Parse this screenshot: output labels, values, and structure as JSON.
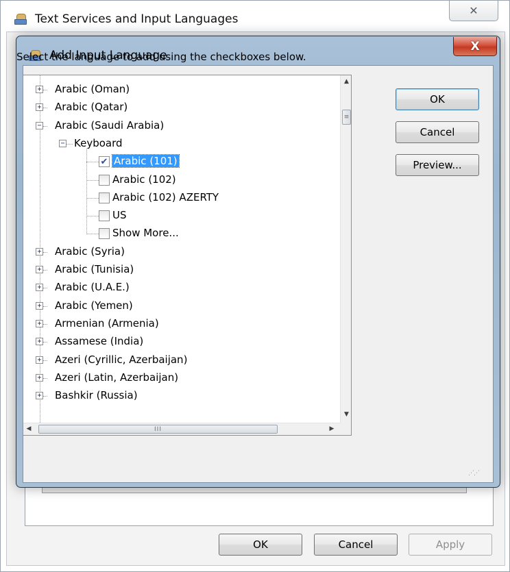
{
  "outer_window": {
    "title": "Text Services and Input Languages",
    "close_glyph": "✕",
    "buttons": {
      "ok": "OK",
      "cancel": "Cancel",
      "apply": "Apply"
    }
  },
  "dialog": {
    "title": "Add Input Language",
    "close_glyph": "X",
    "instruction": "Select the language to add using the checkboxes below.",
    "buttons": {
      "ok": "OK",
      "cancel": "Cancel",
      "preview": "Preview..."
    }
  },
  "tree": {
    "rows": [
      {
        "label": "Arabic (Oman)",
        "level": 0,
        "expander": "+"
      },
      {
        "label": "Arabic (Qatar)",
        "level": 0,
        "expander": "+"
      },
      {
        "label": "Arabic (Saudi Arabia)",
        "level": 0,
        "expander": "−"
      },
      {
        "label": "Keyboard",
        "level": 1,
        "expander": "−"
      },
      {
        "label": "Arabic (101)",
        "level": 2,
        "checked": true,
        "selected": true
      },
      {
        "label": "Arabic (102)",
        "level": 2,
        "checked": false
      },
      {
        "label": "Arabic (102) AZERTY",
        "level": 2,
        "checked": false
      },
      {
        "label": "US",
        "level": 2,
        "checked": false
      },
      {
        "label": "Show More...",
        "level": 2,
        "checked": false
      },
      {
        "label": "Arabic (Syria)",
        "level": 0,
        "expander": "+"
      },
      {
        "label": "Arabic (Tunisia)",
        "level": 0,
        "expander": "+"
      },
      {
        "label": "Arabic (U.A.E.)",
        "level": 0,
        "expander": "+"
      },
      {
        "label": "Arabic (Yemen)",
        "level": 0,
        "expander": "+"
      },
      {
        "label": "Armenian (Armenia)",
        "level": 0,
        "expander": "+"
      },
      {
        "label": "Assamese (India)",
        "level": 0,
        "expander": "+"
      },
      {
        "label": "Azeri (Cyrillic, Azerbaijan)",
        "level": 0,
        "expander": "+"
      },
      {
        "label": "Azeri (Latin, Azerbaijan)",
        "level": 0,
        "expander": "+"
      },
      {
        "label": "Bashkir (Russia)",
        "level": 0,
        "expander": "+"
      }
    ],
    "scroll": {
      "up_glyph": "▲",
      "down_glyph": "▼",
      "left_glyph": "◀",
      "right_glyph": "▶",
      "thumb_grip": "≡",
      "hthumb_grip": "III"
    }
  },
  "icons": {
    "app": "keyboard-globe-icon"
  }
}
